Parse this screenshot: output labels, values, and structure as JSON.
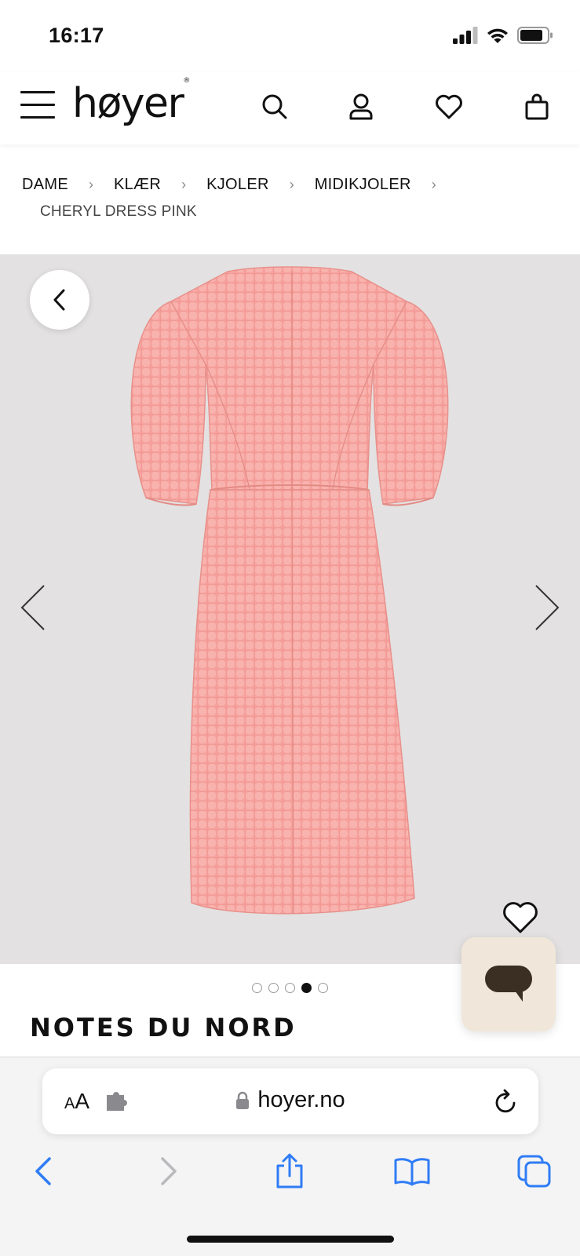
{
  "status_bar": {
    "time": "16:17"
  },
  "header": {
    "logo": "høyer",
    "logo_mark": "®"
  },
  "icons": {
    "menu": "hamburger-menu-icon",
    "search": "search-icon",
    "account": "user-icon",
    "wishlist": "heart-icon",
    "cart": "shopping-bag-icon"
  },
  "breadcrumb": {
    "items": [
      "DAME",
      "KLÆR",
      "KJOLER",
      "MIDIKJOLER"
    ],
    "separator": "›",
    "current": "CHERYL DRESS PINK"
  },
  "gallery": {
    "image_count": 5,
    "active_index": 3,
    "dress_color": "#f6a4a0",
    "background": "#e3e1e1"
  },
  "product": {
    "brand": "NOTES DU NORD"
  },
  "safari": {
    "aa_small": "A",
    "aa_large": "A",
    "url": "hoyer.no",
    "accent": "#2f7cf6"
  }
}
